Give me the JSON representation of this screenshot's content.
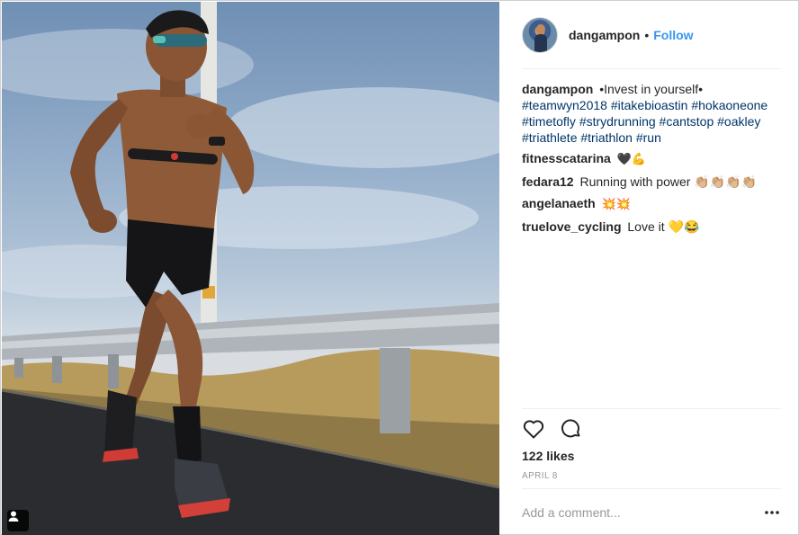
{
  "post": {
    "username": "dangampon",
    "follow_label": "Follow",
    "separator": "•",
    "caption_intro": "•Invest in yourself•",
    "hashtags": [
      "#teamwyn2018",
      "#itakebioastin",
      "#hokaoneone",
      "#timetofly",
      "#strydrunning",
      "#cantstop",
      "#oakley",
      "#triathlete",
      "#triathlon",
      "#run"
    ],
    "likes": "122 likes",
    "date": "APRIL 8"
  },
  "comments": [
    {
      "user": "fitnesscatarina",
      "text": "🖤💪"
    },
    {
      "user": "fedara12",
      "text": "Running with power 👏🏼👏🏼👏🏼👏🏼"
    },
    {
      "user": "angelanaeth",
      "text": "💥💥"
    },
    {
      "user": "truelove_cycling",
      "text": "Love it 💛😂"
    }
  ],
  "add_comment": {
    "placeholder": "Add a comment..."
  },
  "icons": {
    "like": "heart-icon",
    "comment": "comment-bubble-icon",
    "more": "more-options-icon",
    "tagged_users": "user-tag-icon"
  },
  "colors": {
    "accent": "#3897f0",
    "hashtag": "#003569",
    "muted": "#999999"
  }
}
